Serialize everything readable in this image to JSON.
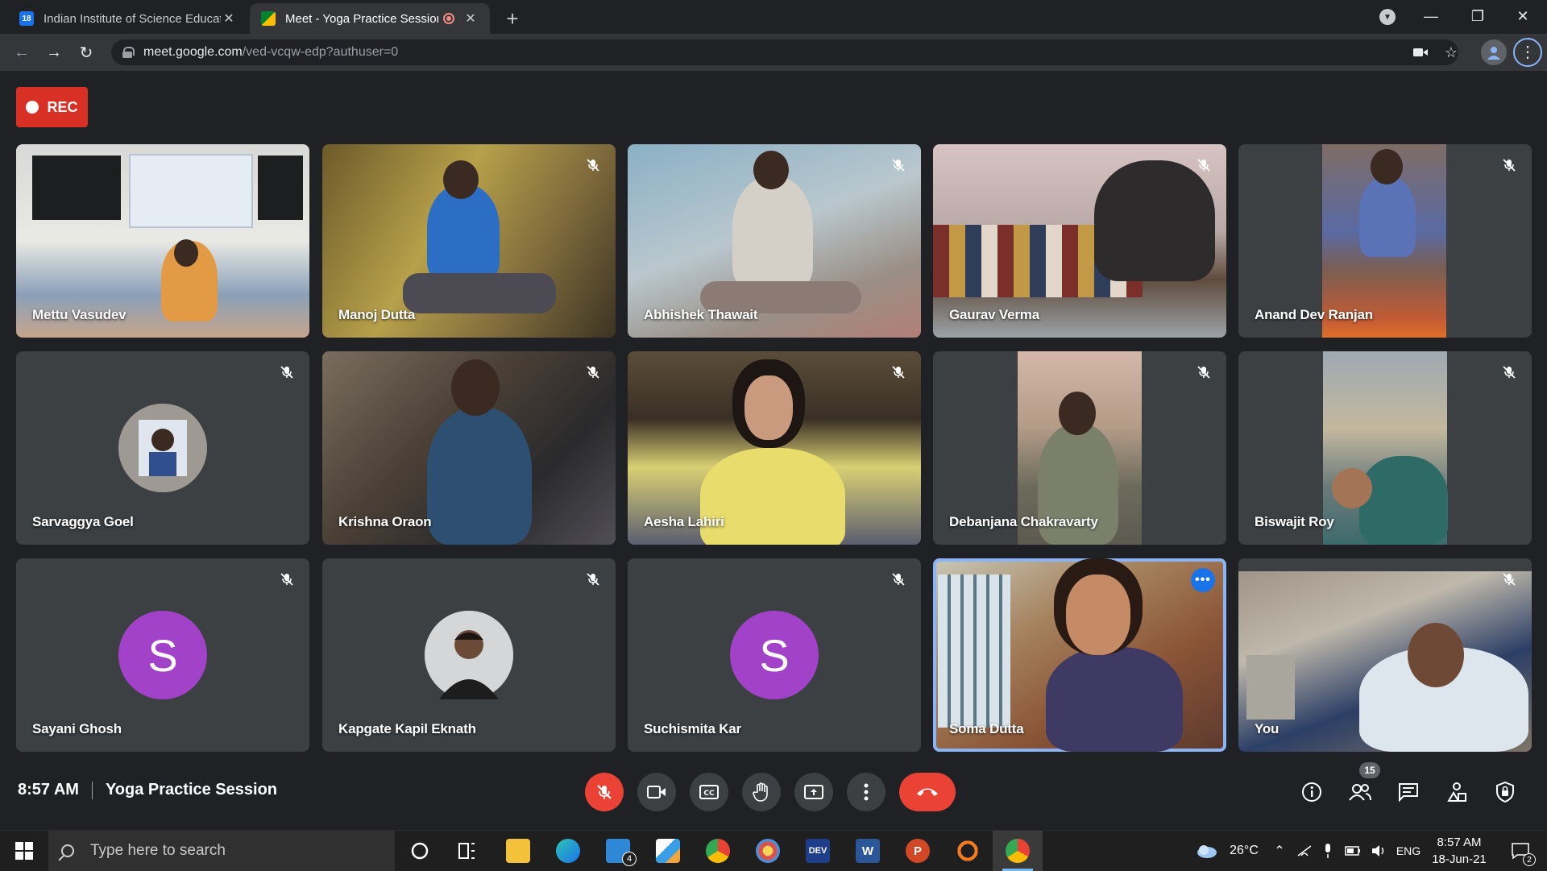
{
  "browser": {
    "tabs": [
      {
        "favicon": "18",
        "title": "Indian Institute of Science Educat",
        "active": false
      },
      {
        "favicon": "meet-icon",
        "title": "Meet - Yoga Practice Session",
        "active": true
      }
    ],
    "url_host": "meet.google.com",
    "url_path": "/ved-vcqw-edp?authuser=0"
  },
  "meet": {
    "rec_label": "REC",
    "participants": [
      {
        "name": "Mettu Vasudev",
        "type": "video",
        "muted": false
      },
      {
        "name": "Manoj Dutta",
        "type": "video",
        "muted": true
      },
      {
        "name": "Abhishek Thawait",
        "type": "video",
        "muted": true
      },
      {
        "name": "Gaurav Verma",
        "type": "video",
        "muted": true
      },
      {
        "name": "Anand Dev Ranjan",
        "type": "video",
        "muted": true
      },
      {
        "name": "Sarvaggya Goel",
        "type": "photo",
        "muted": true
      },
      {
        "name": "Krishna Oraon",
        "type": "video",
        "muted": true
      },
      {
        "name": "Aesha Lahiri",
        "type": "video",
        "muted": true
      },
      {
        "name": "Debanjana Chakravarty",
        "type": "video",
        "muted": true
      },
      {
        "name": "Biswajit Roy",
        "type": "video",
        "muted": true
      },
      {
        "name": "Sayani Ghosh",
        "type": "letter",
        "initial": "S",
        "avatar_color": "#a142c8",
        "muted": true
      },
      {
        "name": "Kapgate Kapil Eknath",
        "type": "photo",
        "muted": true
      },
      {
        "name": "Suchismita Kar",
        "type": "letter",
        "initial": "S",
        "avatar_color": "#a142c8",
        "muted": true
      },
      {
        "name": "Soma Dutta",
        "type": "video",
        "muted": false,
        "active_speaker": true
      },
      {
        "name": "You",
        "type": "video",
        "muted": true
      }
    ],
    "time": "8:57 AM",
    "meeting_title": "Yoga Practice Session",
    "participant_count": "15"
  },
  "taskbar": {
    "search_placeholder": "Type here to search",
    "mail_badge": "4",
    "dev_label": "DEV",
    "word_label": "W",
    "ppt_label": "P",
    "weather": "26°C",
    "lang": "ENG",
    "time": "8:57 AM",
    "date": "18-Jun-21",
    "notifications": "2"
  },
  "colors": {
    "accent_red": "#ea4335",
    "active_speaker_outline": "#8ab4f8",
    "avatar_purple": "#a142c8"
  }
}
